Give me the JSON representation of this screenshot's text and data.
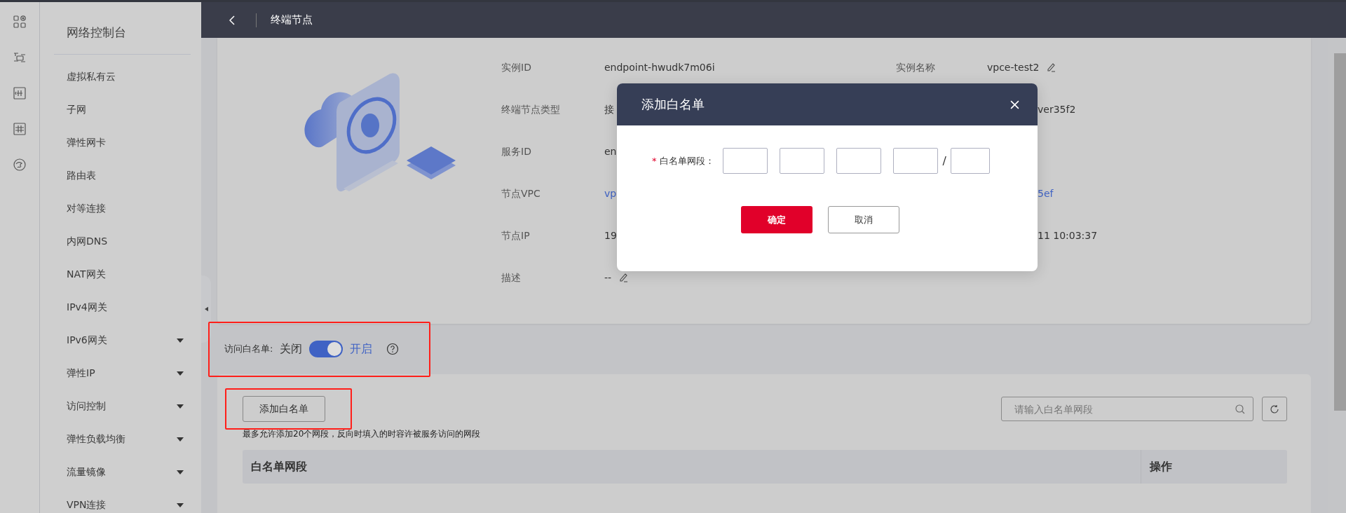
{
  "topbar": {
    "title": "终端节点"
  },
  "sidebar": {
    "title": "网络控制台",
    "items": [
      {
        "label": "虚拟私有云",
        "expandable": false
      },
      {
        "label": "子网",
        "expandable": false
      },
      {
        "label": "弹性网卡",
        "expandable": false
      },
      {
        "label": "路由表",
        "expandable": false
      },
      {
        "label": "对等连接",
        "expandable": false
      },
      {
        "label": "内网DNS",
        "expandable": false
      },
      {
        "label": "NAT网关",
        "expandable": false
      },
      {
        "label": "IPv4网关",
        "expandable": false
      },
      {
        "label": "IPv6网关",
        "expandable": true
      },
      {
        "label": "弹性IP",
        "expandable": true
      },
      {
        "label": "访问控制",
        "expandable": true
      },
      {
        "label": "弹性负载均衡",
        "expandable": true
      },
      {
        "label": "流量镜像",
        "expandable": true
      },
      {
        "label": "VPN连接",
        "expandable": true
      }
    ]
  },
  "details": {
    "rows": [
      {
        "label": "实例ID",
        "value": {
          "text": "endpoint-hwudk7m06i",
          "link": false,
          "editable": false
        },
        "right": {
          "label": "实例名称",
          "text": "vpce-test2",
          "link": false,
          "editable": true
        }
      },
      {
        "label": "终端节点类型",
        "value": {
          "text": "接",
          "link": false
        },
        "right": {
          "text": "ver35f2",
          "link": false
        }
      },
      {
        "label": "服务ID",
        "value": {
          "text": "en",
          "link": false
        }
      },
      {
        "label": "节点VPC",
        "value": {
          "text": "vp",
          "link": true
        },
        "right": {
          "text": "5ef",
          "link": true
        }
      },
      {
        "label": "节点IP",
        "value": {
          "text": "19",
          "link": false
        },
        "right": {
          "text": "11 10:03:37",
          "link": false
        }
      },
      {
        "label": "描述",
        "value": {
          "text": "--",
          "link": false,
          "editable": true
        }
      }
    ]
  },
  "whitelist": {
    "label": "访问白名单:",
    "off_label": "关闭",
    "on_label": "开启",
    "on": true
  },
  "list": {
    "add_button": "添加白名单",
    "hint": "最多允许添加20个网段，反向时填入的时容许被服务访问的网段",
    "search_placeholder": "请输入白名单网段",
    "columns": [
      "白名单网段",
      "操作"
    ]
  },
  "dialog": {
    "title": "添加白名单",
    "required_mark": "*",
    "field_label": "白名单网段：",
    "separator": "/",
    "confirm": "确定",
    "cancel": "取消"
  }
}
